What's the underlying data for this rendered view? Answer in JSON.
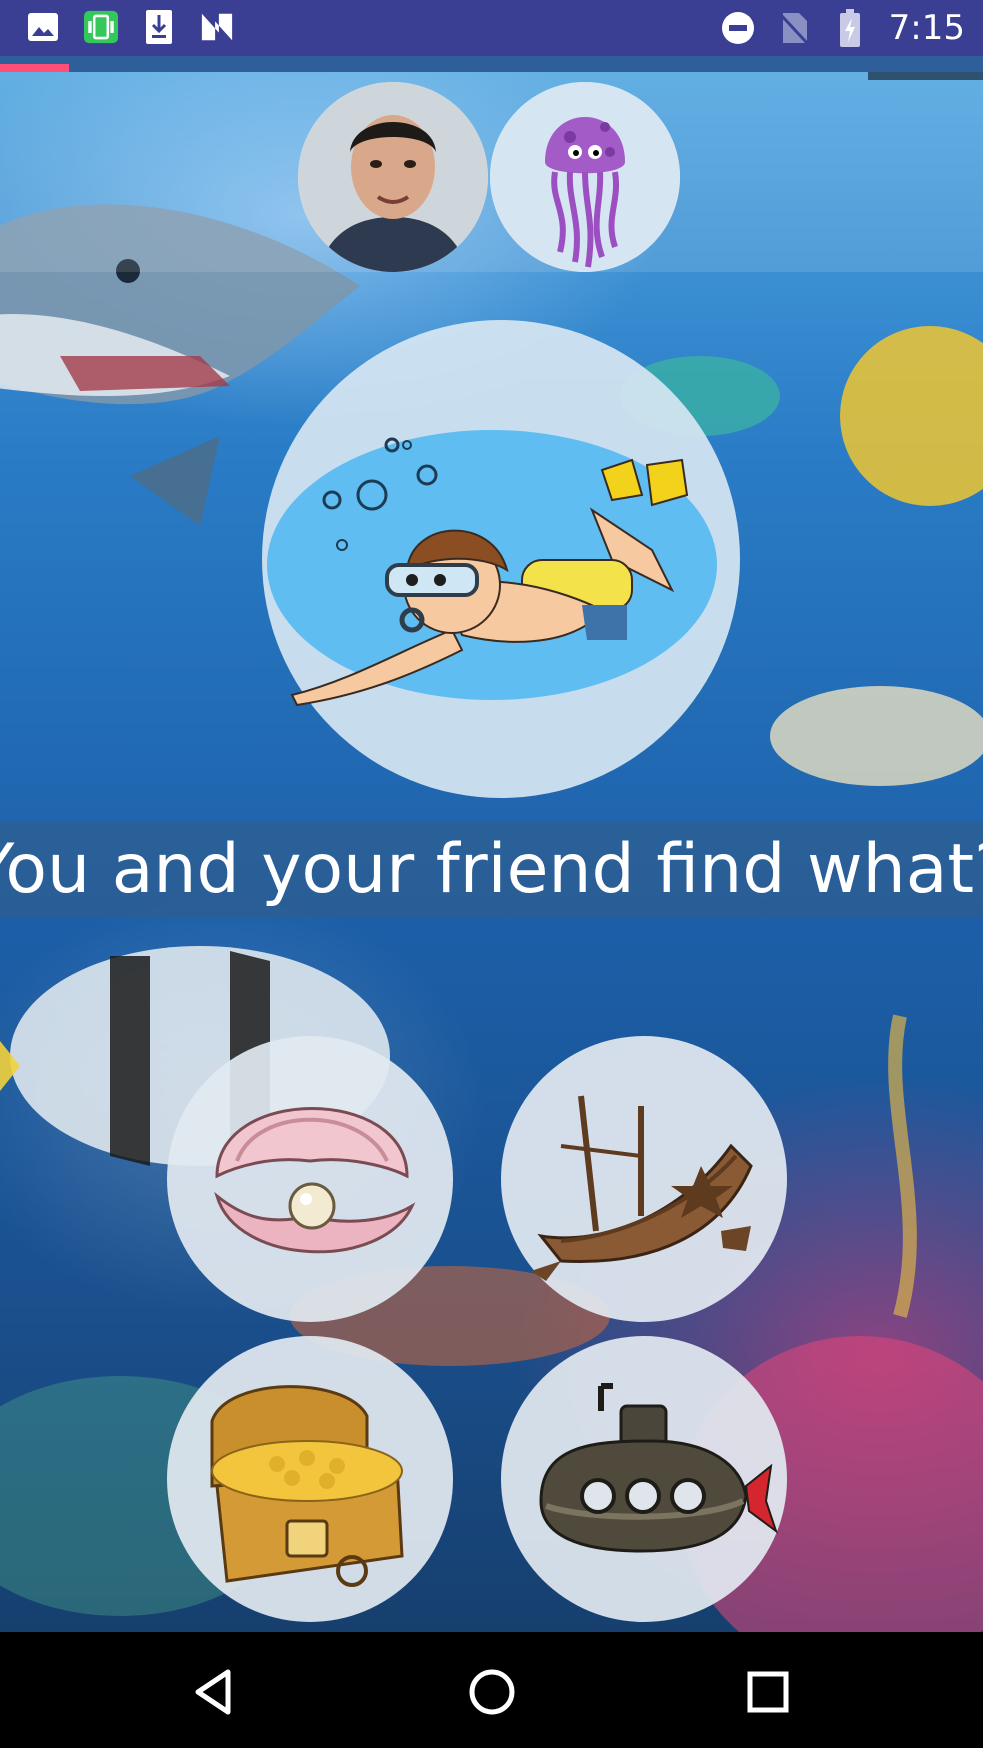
{
  "status_bar": {
    "time": "7:15",
    "left_icons": [
      "image-icon",
      "screen-rotation-icon",
      "download-icon",
      "n-logo-icon"
    ],
    "right_icons": [
      "do-not-disturb-icon",
      "no-sim-icon",
      "battery-charging-icon"
    ]
  },
  "progress": {
    "value_percent": 7
  },
  "players": [
    {
      "name": "player-photo"
    },
    {
      "name": "jellyfish-avatar"
    }
  ],
  "scene_image": "diver-boy",
  "question": {
    "text": "You and your friend find what?"
  },
  "options": [
    {
      "id": "pearl-shell"
    },
    {
      "id": "shipwreck"
    },
    {
      "id": "treasure-chest"
    },
    {
      "id": "submarine"
    }
  ],
  "navbar": {
    "buttons": [
      "back",
      "home",
      "recents"
    ]
  },
  "colors": {
    "status_bar": "#3a3f94",
    "progress_fill": "#ff4f79",
    "ocean": "#1c5fa8",
    "text": "#ffffff"
  }
}
